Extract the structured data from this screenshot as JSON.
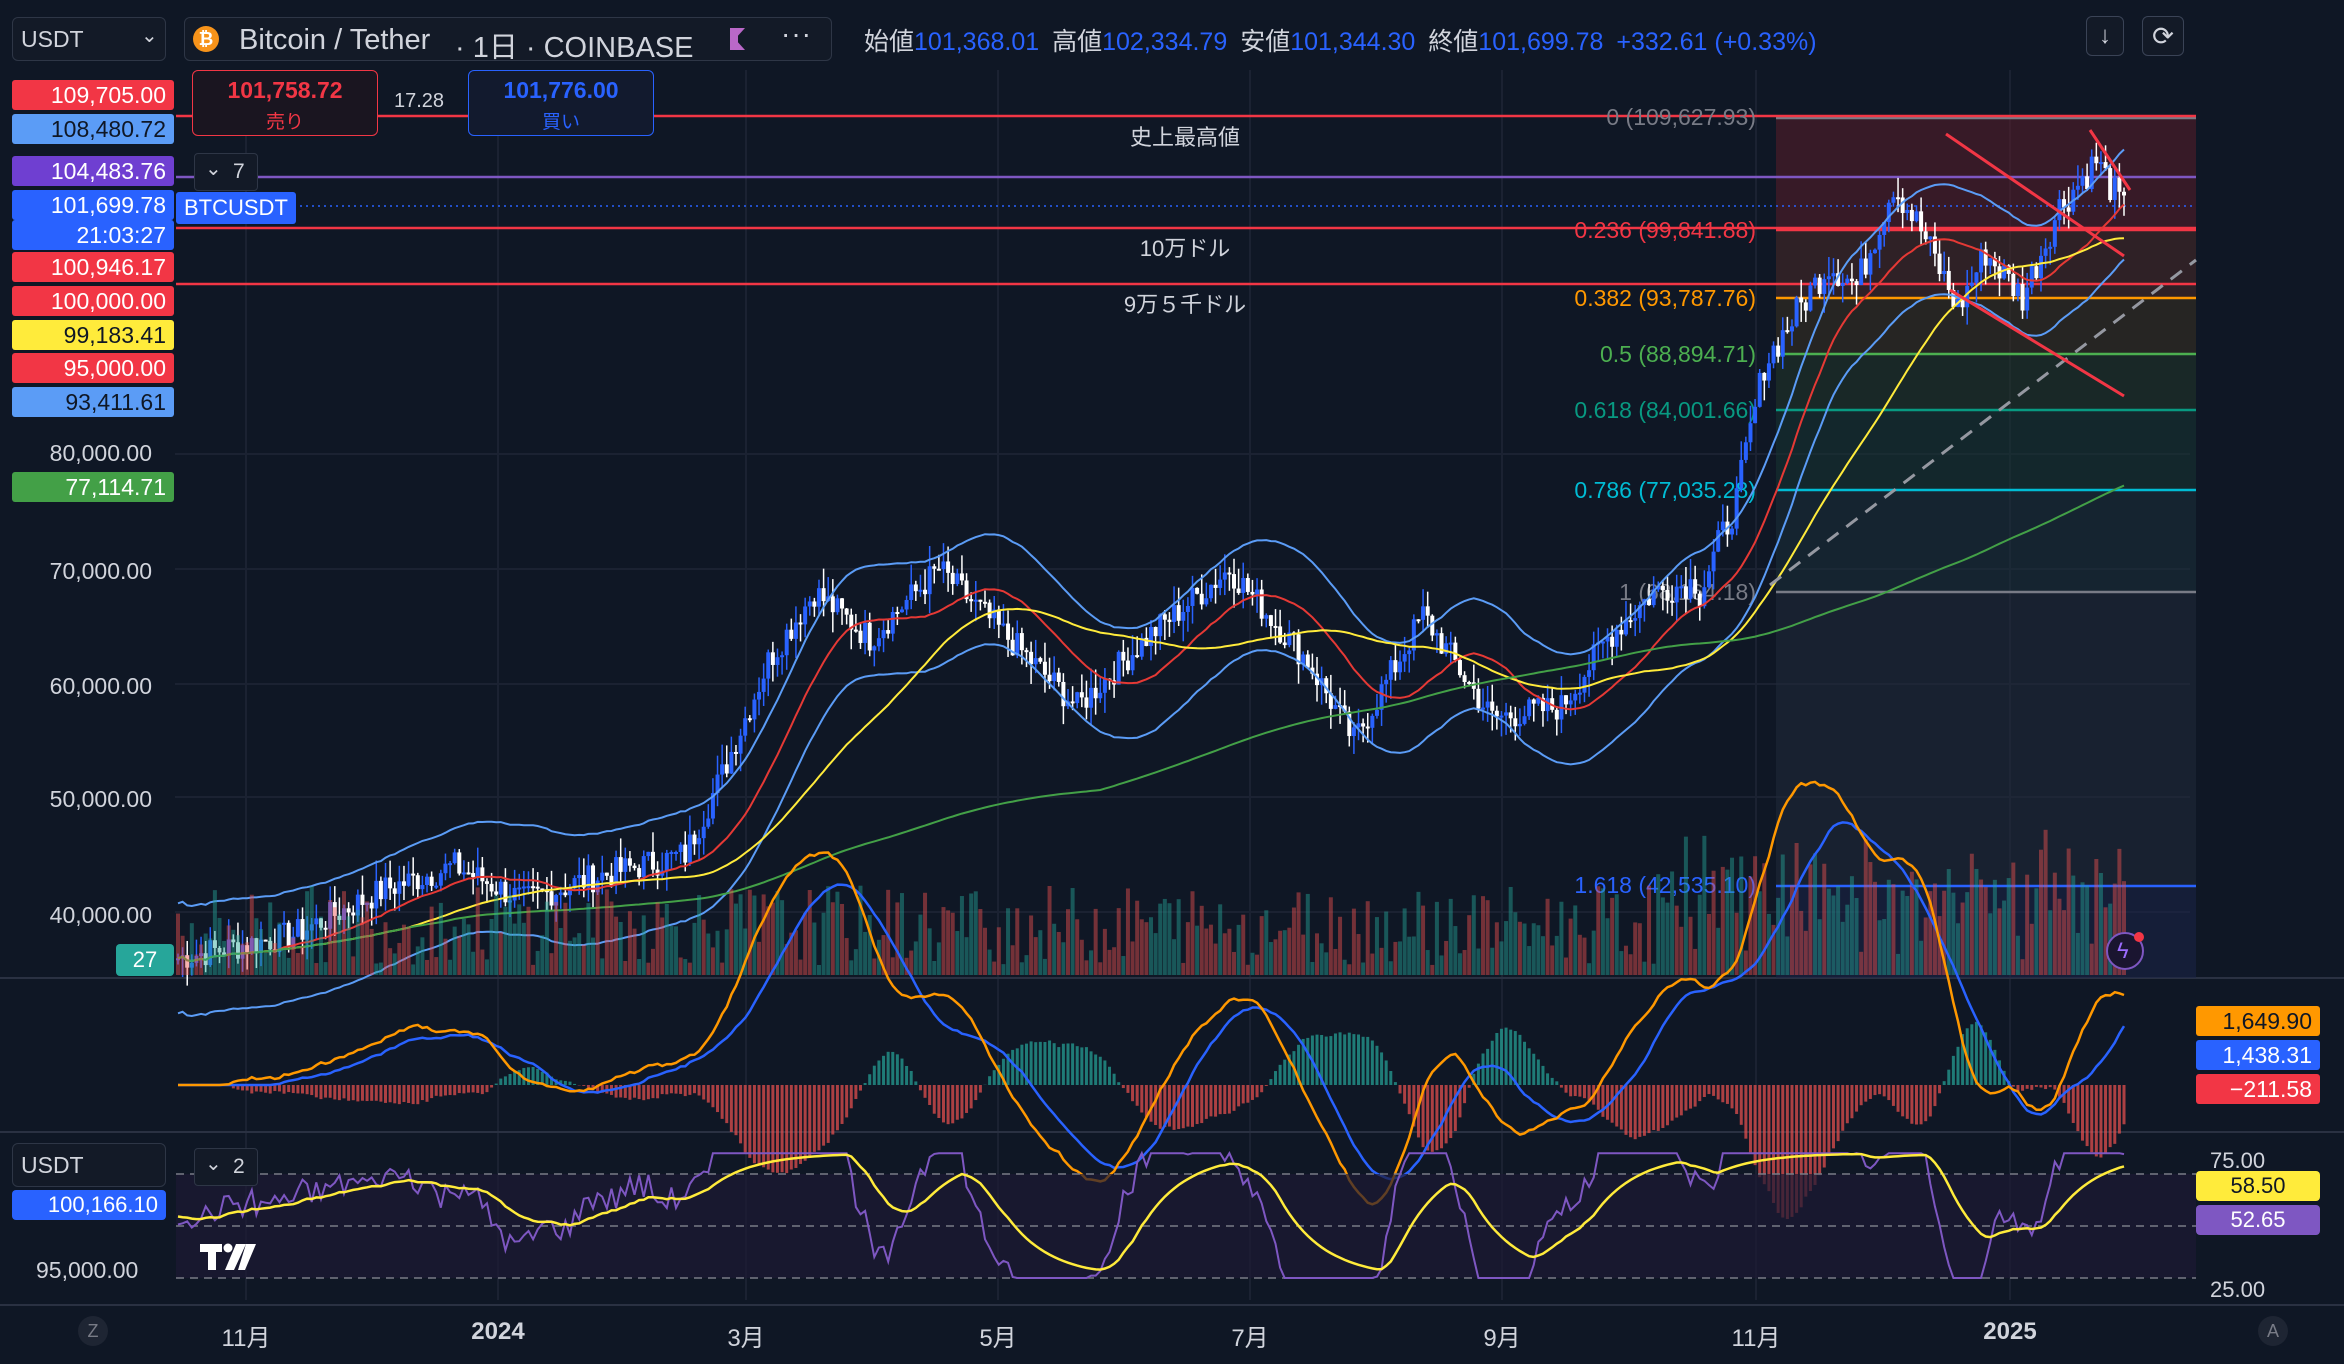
{
  "header": {
    "currency": "USDT",
    "symbol_title": "Bitcoin / Tether",
    "interval_exchange": "· 1日 · COINBASE",
    "ohlc": {
      "open_label": "始値",
      "open": "101,368.01",
      "high_label": "高値",
      "high": "102,334.79",
      "low_label": "安値",
      "low": "101,344.30",
      "close_label": "終値",
      "close": "101,699.78",
      "change": "+332.61 (+0.33%)"
    }
  },
  "trade": {
    "sell_price": "101,758.72",
    "sell_label": "売り",
    "spread": "17.28",
    "buy_price": "101,776.00",
    "buy_label": "買い"
  },
  "legend": {
    "collapsed_count": "7",
    "ticker": "BTCUSDT"
  },
  "lower_panel": {
    "currency": "USDT",
    "collapsed_count": "2",
    "scale_top": "100,166.10",
    "scale_bottom": "95,000.00"
  },
  "price_scale": [
    {
      "text": "109,705.00",
      "bg": "#f23645",
      "fg": "#ffffff"
    },
    {
      "text": "108,480.72",
      "bg": "#5b9cf6",
      "fg": "#0f1725"
    },
    {
      "text": "104,483.76",
      "bg": "#6f3fd1",
      "fg": "#ffffff"
    },
    {
      "text": "101,699.78",
      "bg": "#2962ff",
      "fg": "#ffffff"
    },
    {
      "text": "21:03:27",
      "bg": "#2962ff",
      "fg": "#ffffff"
    },
    {
      "text": "100,946.17",
      "bg": "#f23645",
      "fg": "#ffffff"
    },
    {
      "text": "100,000.00",
      "bg": "#f23645",
      "fg": "#ffffff"
    },
    {
      "text": "99,183.41",
      "bg": "#ffeb3b",
      "fg": "#0f1725"
    },
    {
      "text": "95,000.00",
      "bg": "#f23645",
      "fg": "#ffffff"
    },
    {
      "text": "93,411.61",
      "bg": "#5b9cf6",
      "fg": "#0f1725"
    },
    {
      "text": "80,000.00",
      "bg": "none",
      "fg": "#d1d4dc"
    },
    {
      "text": "77,114.71",
      "bg": "#43a047",
      "fg": "#ffffff"
    },
    {
      "text": "70,000.00",
      "bg": "none",
      "fg": "#d1d4dc"
    },
    {
      "text": "60,000.00",
      "bg": "none",
      "fg": "#d1d4dc"
    },
    {
      "text": "50,000.00",
      "bg": "none",
      "fg": "#d1d4dc"
    },
    {
      "text": "40,000.00",
      "bg": "none",
      "fg": "#d1d4dc"
    }
  ],
  "volume_badge": "27",
  "lines": {
    "ath": "史上最高値",
    "l100k": "10万ドル",
    "l95k": "9万５千ドル"
  },
  "fib": [
    {
      "text": "0 (109,627.93)",
      "color": "#787b86"
    },
    {
      "text": "0.236 (99,841.88)",
      "color": "#f23645"
    },
    {
      "text": "0.382 (93,787.76)",
      "color": "#ff9800"
    },
    {
      "text": "0.5 (88,894.71)",
      "color": "#4caf50"
    },
    {
      "text": "0.618 (84,001.66)",
      "color": "#089981"
    },
    {
      "text": "0.786 (77,035.28)",
      "color": "#00bcd4"
    },
    {
      "text": "1 (68,164.18)",
      "color": "#787b86"
    },
    {
      "text": "1.618 (42,535.10)",
      "color": "#2962ff"
    }
  ],
  "macd_scale": [
    {
      "text": "1,649.90",
      "bg": "#ff9800",
      "fg": "#0f1725"
    },
    {
      "text": "1,438.31",
      "bg": "#2962ff",
      "fg": "#ffffff"
    },
    {
      "text": "−211.58",
      "bg": "#f23645",
      "fg": "#ffffff"
    }
  ],
  "rsi_scale": {
    "top": "75.00",
    "bottom": "25.00",
    "v1": {
      "text": "58.50",
      "bg": "#ffeb3b",
      "fg": "#0f1725"
    },
    "v2": {
      "text": "52.65",
      "bg": "#7e57c2",
      "fg": "#ffffff"
    }
  },
  "time_axis": [
    "11月",
    "2024",
    "3月",
    "5月",
    "7月",
    "9月",
    "11月",
    "2025"
  ],
  "corner": {
    "left": "Z",
    "right": "A"
  },
  "logo": "TV"
}
